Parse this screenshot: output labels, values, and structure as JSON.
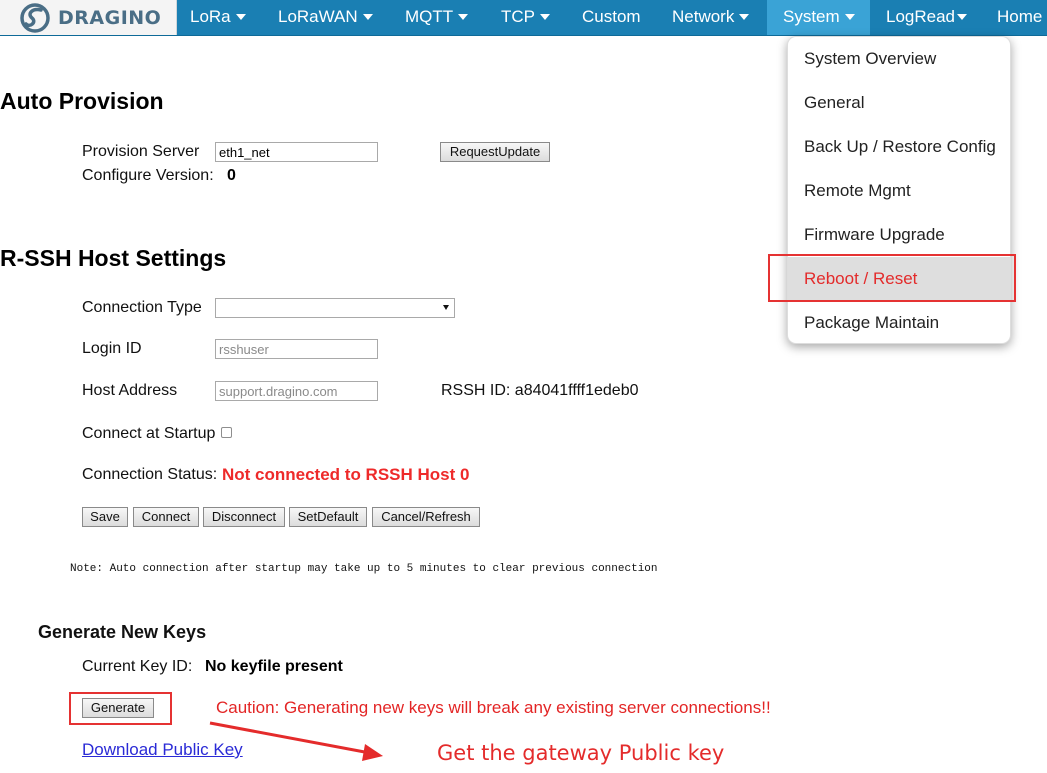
{
  "brand": {
    "name": "DRAGINO"
  },
  "nav": {
    "lora": "LoRa",
    "lorawan": "LoRaWAN",
    "mqtt": "MQTT",
    "tcp": "TCP",
    "custom": "Custom",
    "network": "Network",
    "system": "System",
    "logread": "LogRead",
    "home": "Home"
  },
  "system_menu": {
    "items": [
      "System Overview",
      "General",
      "Back Up / Restore Config",
      "Remote Mgmt",
      "Firmware Upgrade",
      "Reboot / Reset",
      "Package Maintain"
    ],
    "highlighted": "Reboot / Reset"
  },
  "auto_provision": {
    "title": "Auto Provision",
    "server_label": "Provision Server",
    "server_value": "eth1_net",
    "request_button": "RequestUpdate",
    "config_version_label": "Configure Version:",
    "config_version_value": "0"
  },
  "rssh": {
    "title": "R-SSH Host Settings",
    "connection_type_label": "Connection Type",
    "connection_type_value": "",
    "login_id_label": "Login ID",
    "login_id_placeholder": "rsshuser",
    "host_address_label": "Host Address",
    "host_address_placeholder": "support.dragino.com",
    "rssh_id": "RSSH ID: a84041ffff1edeb0",
    "connect_at_startup_label": "Connect at Startup",
    "connect_at_startup_checked": false,
    "status_label": "Connection Status:",
    "status_value": "Not connected to RSSH Host 0",
    "buttons": {
      "save": "Save",
      "connect": "Connect",
      "disconnect": "Disconnect",
      "setdefault": "SetDefault",
      "cancel": "Cancel/Refresh"
    },
    "note": "Note: Auto connection after startup may take up to 5 minutes to clear previous connection"
  },
  "keys": {
    "title": "Generate New Keys",
    "current_label": "Current Key ID:",
    "current_value": "No keyfile present",
    "generate_button": "Generate",
    "caution": "Caution: Generating new keys will break any existing server connections!!",
    "download_link": "Download Public Key"
  },
  "annotation": {
    "text": "Get the gateway Public key"
  },
  "colors": {
    "navbar": "#1a7fb3",
    "nav_active": "#3aa3d6",
    "highlight_red": "#e53232",
    "link_blue": "#2a2ad6"
  }
}
